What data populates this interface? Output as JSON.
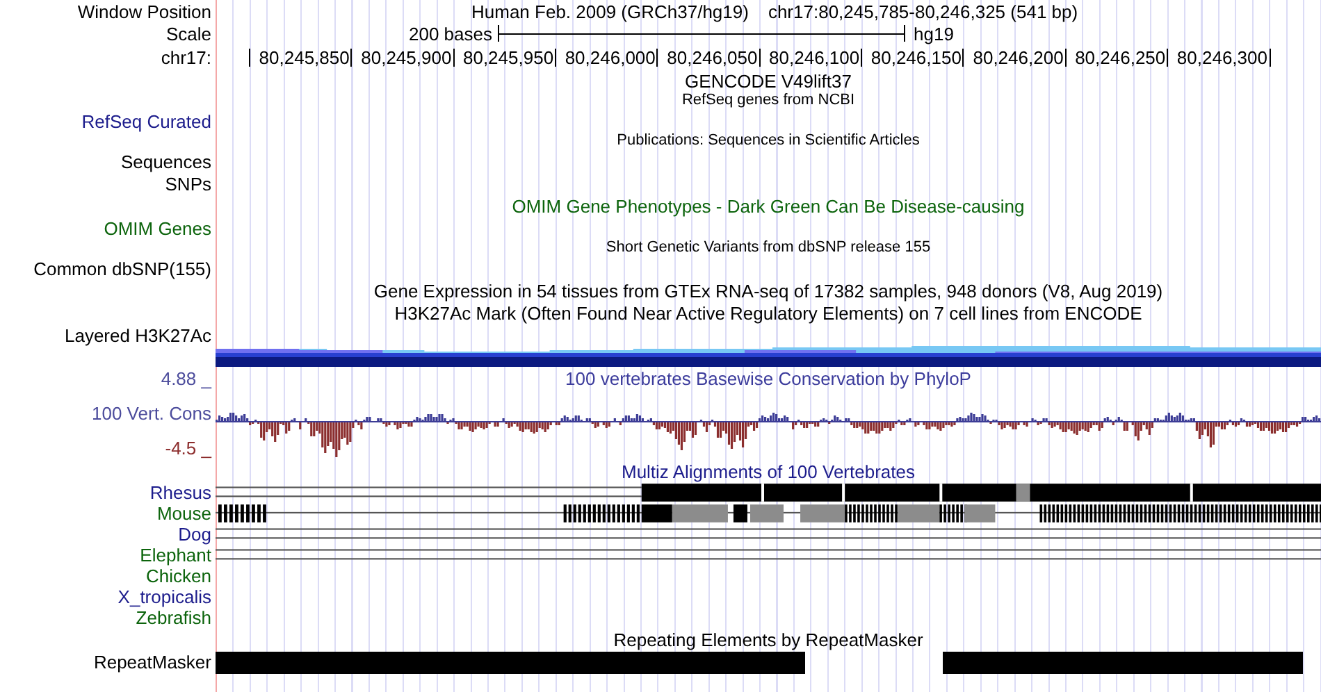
{
  "header": {
    "label": "Window Position",
    "title": "Human Feb. 2009 (GRCh37/hg19)",
    "position": "chr17:80,245,785-80,246,325 (541 bp)"
  },
  "scale": {
    "label": "Scale",
    "length": "200 bases",
    "assembly": "hg19"
  },
  "ruler": {
    "label": "chr17:",
    "ticks": [
      "80,245,850",
      "80,245,900",
      "80,245,950",
      "80,246,000",
      "80,246,050",
      "80,246,100",
      "80,246,150",
      "80,246,200",
      "80,246,250",
      "80,246,300"
    ]
  },
  "rows": [
    {
      "kind": "title",
      "text": "GENCODE V49lift37",
      "color": "#000000"
    },
    {
      "kind": "note",
      "text": "RefSeq genes from NCBI",
      "color": "#000000"
    },
    {
      "kind": "label",
      "label": "RefSeq Curated",
      "color": "#1c1c8c"
    },
    {
      "kind": "note",
      "text": "Publications: Sequences in Scientific Articles",
      "color": "#000000"
    },
    {
      "kind": "label",
      "label": "Sequences",
      "color": "#000000"
    },
    {
      "kind": "label",
      "label": "SNPs",
      "color": "#000000"
    },
    {
      "kind": "title",
      "text": "OMIM Gene Phenotypes - Dark Green Can Be Disease-causing",
      "color": "#0c640c"
    },
    {
      "kind": "label",
      "label": "OMIM Genes",
      "color": "#0c640c"
    },
    {
      "kind": "note",
      "text": "Short Genetic Variants from dbSNP release 155",
      "color": "#000000"
    },
    {
      "kind": "label",
      "label": "Common dbSNP(155)",
      "color": "#000000"
    },
    {
      "kind": "title",
      "text": "Gene Expression in 54 tissues from GTEx RNA-seq of 17382 samples, 948 donors (V8, Aug 2019)",
      "color": "#000000"
    },
    {
      "kind": "title",
      "text": "H3K27Ac Mark (Often Found Near Active Regulatory Elements) on 7 cell lines from ENCODE",
      "color": "#000000"
    },
    {
      "kind": "label",
      "label": "Layered H3K27Ac",
      "color": "#000000"
    },
    {
      "kind": "signal"
    },
    {
      "kind": "axis",
      "label": {
        "text": "4.88 _",
        "color": "#4c4c9c"
      },
      "text": "100 vertebrates Basewise Conservation by PhyloP",
      "color": "#3c3c9c"
    },
    {
      "kind": "wiggle",
      "label": {
        "text": "100 Vert. Cons",
        "color": "#4c4c9c"
      },
      "min_label": {
        "text": "-4.5 _",
        "color": "#8c2c2c"
      }
    },
    {
      "kind": "title",
      "text": "Multiz Alignments of 100 Vertebrates",
      "color": "#1c1c8c"
    },
    {
      "kind": "species",
      "label": "Rhesus",
      "color": "#1c1c8c",
      "alignment": {
        "kind": "block"
      }
    },
    {
      "kind": "species",
      "label": "Mouse",
      "color": "#0c640c",
      "alignment": {
        "kind": "fragmented"
      }
    },
    {
      "kind": "species",
      "label": "Dog",
      "color": "#1c1c8c",
      "alignment": {
        "kind": "thin"
      }
    },
    {
      "kind": "species",
      "label": "Elephant",
      "color": "#0c640c",
      "alignment": {
        "kind": "thin"
      }
    },
    {
      "kind": "species",
      "label": "Chicken",
      "color": "#0c640c",
      "alignment": {
        "kind": "none"
      }
    },
    {
      "kind": "species",
      "label": "X_tropicalis",
      "color": "#1c1c8c",
      "alignment": {
        "kind": "none"
      }
    },
    {
      "kind": "species",
      "label": "Zebrafish",
      "color": "#0c640c",
      "alignment": {
        "kind": "none"
      }
    },
    {
      "kind": "title",
      "text": "Repeating Elements by RepeatMasker",
      "color": "#000000"
    },
    {
      "kind": "repeat",
      "label": "RepeatMasker"
    }
  ]
}
